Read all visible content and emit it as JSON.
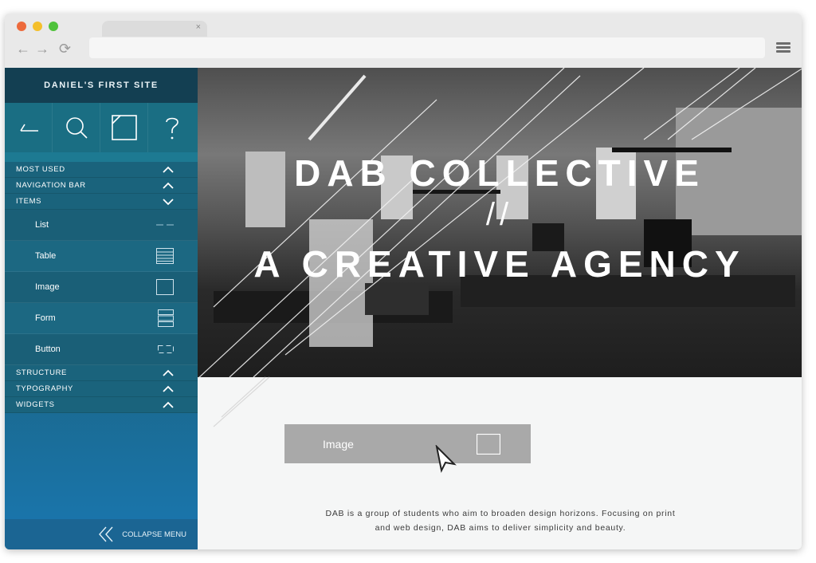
{
  "browser": {
    "nav_back": "←",
    "nav_forward": "→",
    "nav_reload": "⟳",
    "tab_close": "×"
  },
  "sidebar": {
    "site_title": "DANIEL'S FIRST SITE",
    "tools": [
      "back-icon",
      "search-icon",
      "page-icon",
      "help-icon"
    ],
    "sections_top": [
      {
        "label": "MOST USED",
        "state": "collapsed"
      },
      {
        "label": "NAVIGATION BAR",
        "state": "collapsed"
      },
      {
        "label": "ITEMS",
        "state": "expanded"
      }
    ],
    "items": [
      {
        "label": "List",
        "icon": "list-icon"
      },
      {
        "label": "Table",
        "icon": "table-icon"
      },
      {
        "label": "Image",
        "icon": "image-icon"
      },
      {
        "label": "Form",
        "icon": "form-icon"
      },
      {
        "label": "Button",
        "icon": "button-icon"
      }
    ],
    "sections_bottom": [
      {
        "label": "STRUCTURE",
        "state": "collapsed"
      },
      {
        "label": "TYPOGRAPHY",
        "state": "collapsed"
      },
      {
        "label": "WIDGETS",
        "state": "collapsed"
      }
    ],
    "collapse_label": "COLLAPSE MENU"
  },
  "hero": {
    "title": "DAB COLLECTIVE",
    "separator": "//",
    "subtitle": "A CREATIVE AGENCY"
  },
  "image_widget": {
    "label": "Image"
  },
  "about": {
    "line1": "DAB is a group of students who aim to broaden design horizons. Focusing on print",
    "line2": "and web design, DAB aims to deliver simplicity and beauty."
  },
  "colors": {
    "sidebar_dark": "#133f52",
    "sidebar_mid": "#1a637c",
    "sidebar_bottom": "#1a77b0",
    "widget_gray": "#a9a9a9"
  }
}
